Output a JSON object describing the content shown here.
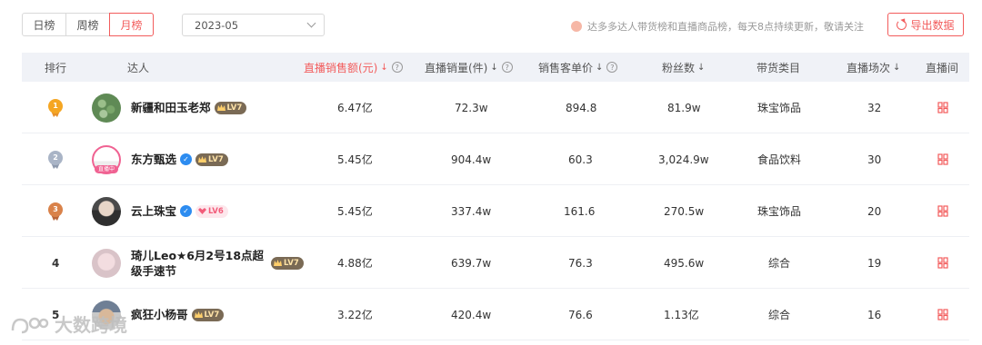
{
  "tabs": [
    {
      "label": "日榜",
      "active": false
    },
    {
      "label": "周榜",
      "active": false
    },
    {
      "label": "月榜",
      "active": true
    }
  ],
  "date_select": {
    "value": "2023-05"
  },
  "notice": "达多多达人带货榜和直播商品榜，每天8点持续更新，敬请关注",
  "export_label": "导出数据",
  "columns": {
    "rank": "排行",
    "streamer": "达人",
    "sales_amount": "直播销售额(元)",
    "sales_volume": "直播销量(件)",
    "unit_price": "销售客单价",
    "fans": "粉丝数",
    "category": "带货类目",
    "sessions": "直播场次",
    "live_room": "直播间"
  },
  "rows": [
    {
      "rank": "1",
      "name": "新疆和田玉老郑",
      "verified": false,
      "level": "LV7",
      "level_style": "gold",
      "sales_amount": "6.47亿",
      "sales_volume": "72.3w",
      "unit_price": "894.8",
      "fans": "81.9w",
      "category": "珠宝饰品",
      "sessions": "32"
    },
    {
      "rank": "2",
      "name": "东方甄选",
      "verified": true,
      "level": "LV7",
      "level_style": "gold",
      "sales_amount": "5.45亿",
      "sales_volume": "904.4w",
      "unit_price": "60.3",
      "fans": "3,024.9w",
      "category": "食品饮料",
      "sessions": "30"
    },
    {
      "rank": "3",
      "name": "云上珠宝",
      "verified": true,
      "level": "LV6",
      "level_style": "pink",
      "sales_amount": "5.45亿",
      "sales_volume": "337.4w",
      "unit_price": "161.6",
      "fans": "270.5w",
      "category": "珠宝饰品",
      "sessions": "20"
    },
    {
      "rank": "4",
      "name_line1": "琦儿Leo★6月2号18点超",
      "name_line2": "级手速节",
      "verified": false,
      "level": "LV7",
      "level_style": "gold",
      "sales_amount": "4.88亿",
      "sales_volume": "639.7w",
      "unit_price": "76.3",
      "fans": "495.6w",
      "category": "综合",
      "sessions": "19"
    },
    {
      "rank": "5",
      "name": "疯狂小杨哥",
      "verified": false,
      "level": "LV7",
      "level_style": "gold",
      "sales_amount": "3.22亿",
      "sales_volume": "420.4w",
      "unit_price": "76.6",
      "fans": "1.13亿",
      "category": "综合",
      "sessions": "16"
    }
  ],
  "avatar_badge": "直播中",
  "watermark": "大数跨境",
  "colors": {
    "accent": "#f25c5c",
    "header_bg": "#f0f2f7",
    "gold_medal": "#f5a623",
    "silver_medal": "#a9b4c6",
    "bronze_medal": "#d9824a"
  }
}
